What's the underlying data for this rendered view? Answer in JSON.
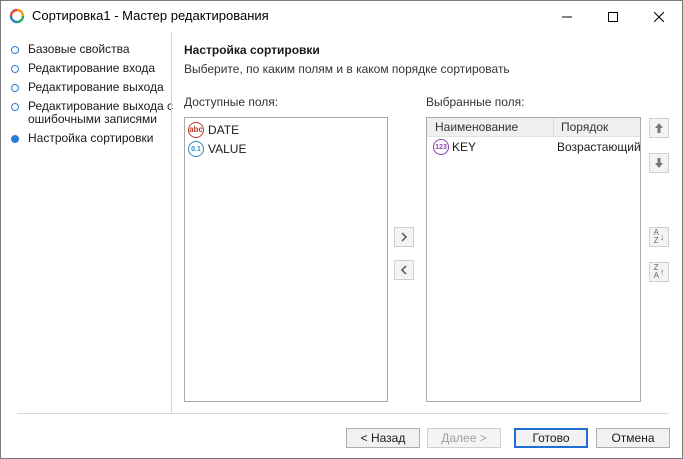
{
  "window": {
    "title": "Сортировка1 - Мастер редактирования",
    "minimize_icon": "minimize-icon",
    "maximize_icon": "maximize-icon",
    "close_icon": "close-icon"
  },
  "steps": [
    {
      "label": "Базовые свойства",
      "active": false
    },
    {
      "label": "Редактирование входа",
      "active": false
    },
    {
      "label": "Редактирование выхода",
      "active": false
    },
    {
      "label": "Редактирование выхода с ошибочными записями",
      "active": false
    },
    {
      "label": "Настройка сортировки",
      "active": true
    }
  ],
  "page": {
    "heading": "Настройка сортировки",
    "subheading": "Выберите, по каким полям и в каком порядке сортировать"
  },
  "available": {
    "caption": "Доступные поля:",
    "fields": [
      {
        "name": "DATE",
        "type_icon": "abc"
      },
      {
        "name": "VALUE",
        "type_icon": "0.1"
      }
    ]
  },
  "selected": {
    "caption": "Выбранные поля:",
    "columns": [
      "Наименование",
      "Порядок"
    ],
    "rows": [
      {
        "name": "KEY",
        "order": "Возрастающий",
        "type_icon": "123"
      }
    ]
  },
  "transfer": {
    "add_icon": "chevron-right-icon",
    "remove_icon": "chevron-left-icon"
  },
  "order_controls": {
    "move_up_icon": "arrow-up-icon",
    "move_down_icon": "arrow-down-icon",
    "sort_asc_icon": "sort-ascending-icon",
    "sort_desc_icon": "sort-descending-icon",
    "sort_asc_top": "A",
    "sort_asc_bottom": "Z",
    "sort_desc_top": "Z",
    "sort_desc_bottom": "A"
  },
  "buttons": {
    "back": "< Назад",
    "next": "Далее >",
    "finish": "Готово",
    "cancel": "Отмена"
  }
}
